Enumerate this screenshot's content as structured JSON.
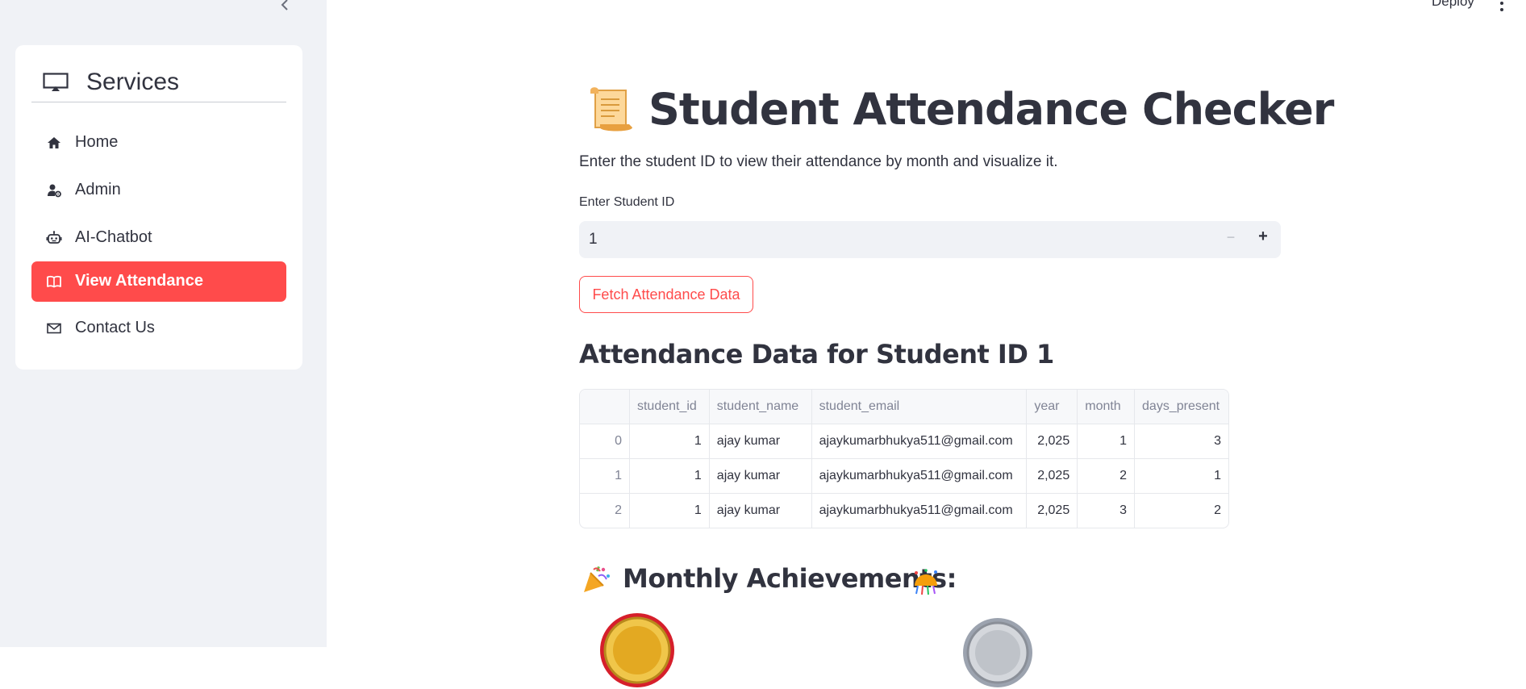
{
  "sidebar": {
    "collapse_icon": "chevron-left-icon",
    "menu_title": "Services",
    "menu_title_icon": "tv-icon",
    "items": [
      {
        "label": "Home",
        "icon": "house-icon",
        "active": false
      },
      {
        "label": "Admin",
        "icon": "person-gear-icon",
        "active": false
      },
      {
        "label": "AI-Chatbot",
        "icon": "robot-icon",
        "active": false
      },
      {
        "label": "View Attendance",
        "icon": "book-icon",
        "active": true
      },
      {
        "label": "Contact Us",
        "icon": "envelope-icon",
        "active": false
      }
    ],
    "active_color": "#ff4b4b"
  },
  "header": {
    "deploy_label": "Deploy",
    "menu_icon": "kebab-menu-icon"
  },
  "main": {
    "title_icon": "scroll-icon",
    "title": "Student Attendance Checker",
    "description": "Enter the student ID to view their attendance by month and visualize it.",
    "input_label": "Enter Student ID",
    "input_value": "1",
    "minus_label": "−",
    "plus_label": "+",
    "fetch_button": "Fetch Attendance Data",
    "data_heading": "Attendance Data for Student ID 1",
    "table": {
      "columns": [
        "",
        "student_id",
        "student_name",
        "student_email",
        "year",
        "month",
        "days_present"
      ],
      "rows": [
        [
          "0",
          "1",
          "ajay kumar",
          "ajaykumarbhukya511@gmail.com",
          "2,025",
          "1",
          "3"
        ],
        [
          "1",
          "1",
          "ajay kumar",
          "ajaykumarbhukya511@gmail.com",
          "2,025",
          "2",
          "1"
        ],
        [
          "2",
          "1",
          "ajay kumar",
          "ajaykumarbhukya511@gmail.com",
          "2,025",
          "3",
          "2"
        ]
      ]
    },
    "achievements_heading": "Monthly Achievements:",
    "achievements_icons": [
      "party-popper-icon",
      "confetti-ball-icon",
      "gold-medal-icon",
      "silver-medal-icon"
    ]
  }
}
